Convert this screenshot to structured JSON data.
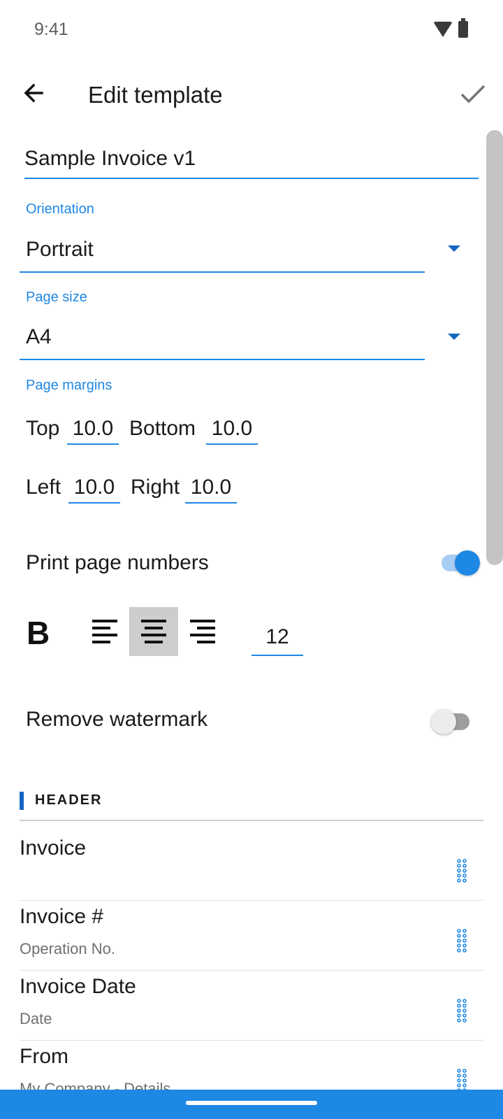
{
  "status_bar": {
    "time": "9:41",
    "icons": [
      "wifi-icon",
      "battery-icon"
    ]
  },
  "app_bar": {
    "title": "Edit template",
    "back_icon": "arrow-left-icon",
    "confirm_icon": "check-icon"
  },
  "template_name": "Sample Invoice v1",
  "orientation": {
    "label": "Orientation",
    "value": "Portrait"
  },
  "page_size": {
    "label": "Page size",
    "value": "A4"
  },
  "page_margins": {
    "label": "Page margins",
    "top_label": "Top",
    "top_value": "10.0",
    "bottom_label": "Bottom",
    "bottom_value": "10.0",
    "left_label": "Left",
    "left_value": "10.0",
    "right_label": "Right",
    "right_value": "10.0"
  },
  "print_page_numbers": {
    "label": "Print page numbers",
    "enabled": true
  },
  "formatting": {
    "bold_label": "B",
    "alignments": [
      "align-left-icon",
      "align-center-icon",
      "align-right-icon"
    ],
    "selected_alignment": "center",
    "font_size": "12"
  },
  "remove_watermark": {
    "label": "Remove watermark",
    "enabled": false
  },
  "header_section": {
    "title": "HEADER",
    "items": [
      {
        "title": "Invoice",
        "subtitle": ""
      },
      {
        "title": "Invoice #",
        "subtitle": "Operation No."
      },
      {
        "title": "Invoice Date",
        "subtitle": "Date"
      },
      {
        "title": "From",
        "subtitle": "My Company - Details"
      }
    ]
  },
  "colors": {
    "accent": "#1e88e5",
    "accent_dark": "#1565c0",
    "selected_bg": "#cdcdcd"
  }
}
